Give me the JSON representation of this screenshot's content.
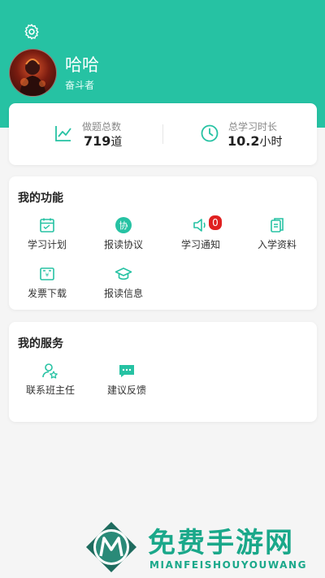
{
  "profile": {
    "name": "哈哈",
    "tag": "奋斗者"
  },
  "stats": {
    "questions_label": "做题总数",
    "questions_value": "719",
    "questions_unit": "道",
    "hours_label": "总学习时长",
    "hours_value": "10.2",
    "hours_unit": "小时"
  },
  "functions": {
    "title": "我的功能",
    "items": [
      {
        "label": "学习计划",
        "icon": "calendar-icon"
      },
      {
        "label": "报读协议",
        "icon": "agreement-icon"
      },
      {
        "label": "学习通知",
        "icon": "speaker-icon",
        "badge": "0"
      },
      {
        "label": "入学资料",
        "icon": "documents-icon"
      },
      {
        "label": "发票下载",
        "icon": "invoice-icon"
      },
      {
        "label": "报读信息",
        "icon": "graduation-cap-icon"
      }
    ]
  },
  "services": {
    "title": "我的服务",
    "items": [
      {
        "label": "联系班主任",
        "icon": "contact-teacher-icon"
      },
      {
        "label": "建议反馈",
        "icon": "feedback-icon"
      }
    ]
  },
  "watermark": {
    "title": "免费手游网",
    "subtitle": "MIANFEISHOUYOUWANG"
  },
  "colors": {
    "accent": "#26c2a3",
    "badge": "#e02020",
    "watermark": "#1aa88a"
  }
}
